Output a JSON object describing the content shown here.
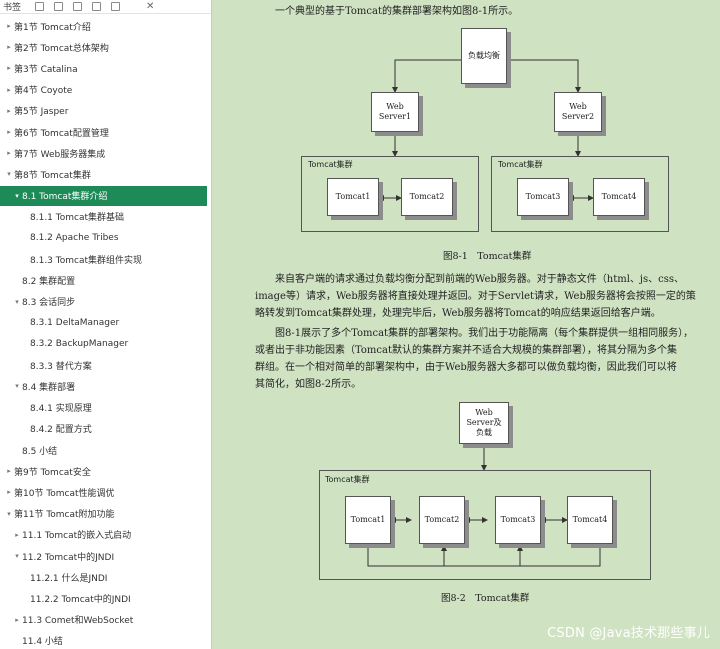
{
  "sidebar": {
    "title": "书签",
    "items": [
      {
        "label": "第1节 Tomcat介绍",
        "level": 0,
        "tri": "▸"
      },
      {
        "label": "第2节 Tomcat总体架构",
        "level": 0,
        "tri": "▸"
      },
      {
        "label": "第3节 Catalina",
        "level": 0,
        "tri": "▸"
      },
      {
        "label": "第4节 Coyote",
        "level": 0,
        "tri": "▸"
      },
      {
        "label": "第5节 Jasper",
        "level": 0,
        "tri": "▸"
      },
      {
        "label": "第6节 Tomcat配置管理",
        "level": 0,
        "tri": "▸"
      },
      {
        "label": "第7节 Web服务器集成",
        "level": 0,
        "tri": "▸"
      },
      {
        "label": "第8节 Tomcat集群",
        "level": 0,
        "tri": "▾"
      },
      {
        "label": "8.1 Tomcat集群介绍",
        "level": 1,
        "tri": "▾",
        "active": true
      },
      {
        "label": "8.1.1 Tomcat集群基础",
        "level": 2,
        "tri": ""
      },
      {
        "label": "8.1.2 Apache Tribes",
        "level": 2,
        "tri": ""
      },
      {
        "label": "8.1.3 Tomcat集群组件实现",
        "level": 2,
        "tri": ""
      },
      {
        "label": "8.2 集群配置",
        "level": 1,
        "tri": ""
      },
      {
        "label": "8.3 会话同步",
        "level": 1,
        "tri": "▾"
      },
      {
        "label": "8.3.1 DeltaManager",
        "level": 2,
        "tri": ""
      },
      {
        "label": "8.3.2 BackupManager",
        "level": 2,
        "tri": ""
      },
      {
        "label": "8.3.3 替代方案",
        "level": 2,
        "tri": ""
      },
      {
        "label": "8.4 集群部署",
        "level": 1,
        "tri": "▾"
      },
      {
        "label": "8.4.1 实现原理",
        "level": 2,
        "tri": ""
      },
      {
        "label": "8.4.2 配置方式",
        "level": 2,
        "tri": ""
      },
      {
        "label": "8.5 小结",
        "level": 1,
        "tri": ""
      },
      {
        "label": "第9节 Tomcat安全",
        "level": 0,
        "tri": "▸"
      },
      {
        "label": "第10节 Tomcat性能调优",
        "level": 0,
        "tri": "▸"
      },
      {
        "label": "第11节 Tomcat附加功能",
        "level": 0,
        "tri": "▾"
      },
      {
        "label": "11.1 Tomcat的嵌入式启动",
        "level": 1,
        "tri": "▸"
      },
      {
        "label": "11.2 Tomcat中的JNDI",
        "level": 1,
        "tri": "▾"
      },
      {
        "label": "11.2.1 什么是JNDI",
        "level": 2,
        "tri": ""
      },
      {
        "label": "11.2.2 Tomcat中的JNDI",
        "level": 2,
        "tri": ""
      },
      {
        "label": "11.3 Comet和WebSocket",
        "level": 1,
        "tri": "▸"
      },
      {
        "label": "11.4 小结",
        "level": 1,
        "tri": ""
      }
    ]
  },
  "doc": {
    "intro": "一个典型的基于Tomcat的集群部署架构如图8-1所示。",
    "fig1": {
      "lb": "负载均衡",
      "ws1": [
        "Web",
        "Server1"
      ],
      "ws2": [
        "Web",
        "Server2"
      ],
      "cluster_label": "Tomcat集群",
      "nodes": [
        "Tomcat1",
        "Tomcat2",
        "Tomcat3",
        "Tomcat4"
      ],
      "caption": "图8-1　Tomcat集群"
    },
    "para1": [
      "来自客户端的请求通过负载均衡分配到前端的Web服务器。对于静态文件（html、js、css、",
      "image等）请求，Web服务器将直接处理并返回。对于Servlet请求，Web服务器将会按照一定的策",
      "略转发到Tomcat集群处理，处理完毕后，Web服务器将Tomcat的响应结果返回给客户端。"
    ],
    "para2": [
      "图8-1展示了多个Tomcat集群的部署架构。我们出于功能隔离（每个集群提供一组相同服务），",
      "或者出于非功能因素（Tomcat默认的集群方案并不适合大规模的集群部署），将其分隔为多个集",
      "群组。在一个相对简单的部署架构中，由于Web服务器大多都可以做负载均衡，因此我们可以将",
      "其简化，如图8-2所示。"
    ],
    "fig2": {
      "ws": [
        "Web",
        "Server及",
        "负载"
      ],
      "cluster_label": "Tomcat集群",
      "nodes": [
        "Tomcat1",
        "Tomcat2",
        "Tomcat3",
        "Tomcat4"
      ],
      "caption": "图8-2　Tomcat集群"
    }
  },
  "watermark": "CSDN @Java技术那些事儿"
}
